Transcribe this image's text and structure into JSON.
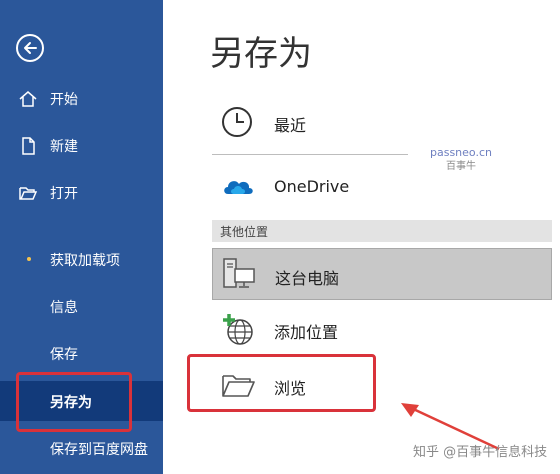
{
  "sidebar": {
    "back_icon": "back-arrow-icon",
    "items": [
      {
        "label": "开始",
        "icon": "home-icon"
      },
      {
        "label": "新建",
        "icon": "new-document-icon"
      },
      {
        "label": "打开",
        "icon": "open-folder-icon"
      },
      {
        "label": "获取加载项",
        "icon": "dot-icon"
      },
      {
        "label": "信息"
      },
      {
        "label": "保存"
      },
      {
        "label": "另存为",
        "active": true
      },
      {
        "label": "保存到百度网盘"
      }
    ]
  },
  "main": {
    "title": "另存为",
    "recent": {
      "label": "最近",
      "icon": "clock-icon"
    },
    "onedrive": {
      "label": "OneDrive",
      "icon": "onedrive-cloud-icon"
    },
    "other_locations_header": "其他位置",
    "this_pc": {
      "label": "这台电脑",
      "icon": "computer-icon",
      "selected": true
    },
    "add_place": {
      "label": "添加位置",
      "icon": "globe-plus-icon"
    },
    "browse": {
      "label": "浏览",
      "icon": "folder-icon"
    }
  },
  "watermark": {
    "line1": "passneo.cn",
    "line2": "百事牛"
  },
  "credit": "知乎 @百事牛信息科技",
  "colors": {
    "sidebar": "#2b579a",
    "sidebar_active": "#123a7a",
    "highlight_box": "#d9323a",
    "arrow": "#e0403a"
  }
}
